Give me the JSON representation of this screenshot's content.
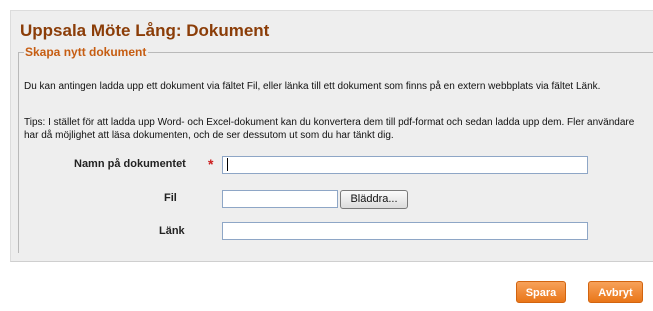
{
  "page": {
    "title": "Uppsala Möte Lång: Dokument"
  },
  "form": {
    "legend": "Skapa nytt dokument",
    "intro_text": "Du kan antingen ladda upp ett dokument via fältet Fil, eller länka till ett dokument som finns på en extern webbplats via fältet Länk.",
    "tip_text": "Tips: I stället för att ladda upp Word- och Excel-dokument kan du konvertera dem till pdf-format och sedan ladda upp dem. Fler användare har då möjlighet att läsa dokumenten, och de ser dessutom ut som du har tänkt dig.",
    "fields": {
      "name": {
        "label": "Namn på dokumentet",
        "required_marker": "*",
        "value": ""
      },
      "file": {
        "label": "Fil",
        "value": "",
        "browse_label": "Bläddra..."
      },
      "link": {
        "label": "Länk",
        "value": ""
      }
    }
  },
  "actions": {
    "save_label": "Spara",
    "cancel_label": "Avbryt"
  },
  "colors": {
    "title": "#8b3d08",
    "legend": "#c65d12",
    "panel_background": "#eeeeee",
    "required": "#cc1d1d",
    "button_orange": "#e97618",
    "input_border": "#8ea6c6"
  }
}
